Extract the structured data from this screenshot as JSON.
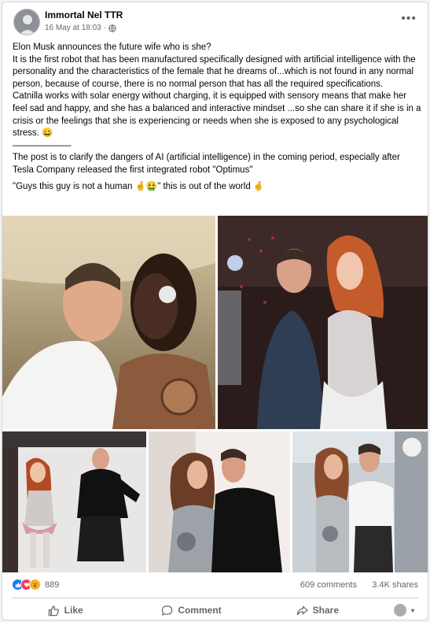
{
  "post": {
    "author": "Immortal Nel TTR",
    "timestamp": "16 May at 18:03",
    "privacy_dot": "·",
    "more_label": "•••",
    "paragraphs": [
      "Elon Musk announces the future wife who is she?",
      "It is the first robot that has been manufactured specifically designed with artificial intelligence with the personality and the characteristics of the female that he dreams of...which is not found in any normal person, because of course, there is no normal person that has all the required specifications.",
      "Catnilla works with solar energy without charging, it is equipped with sensory means that make her feel sad and happy, and she has a balanced and interactive mindset ...so she can share it if she is in a crisis or the feelings that she is experiencing or needs when she is exposed to any psychological stress. 😀"
    ],
    "separator": "———————",
    "note": "The post is to clarify the dangers of AI (artificial intelligence) in the coming period, especially after Tesla Company released the first integrated robot \"Optimus\"",
    "quote": "\"Guys this guy is not a human 🤞🤮\" this is out of the world 🤞"
  },
  "photos": [
    {
      "name": "photo-man-kissing-dark-robot"
    },
    {
      "name": "photo-man-dancing-redhead-robot"
    },
    {
      "name": "photo-man-dancing-robot-studio"
    },
    {
      "name": "photo-man-kissing-robot"
    },
    {
      "name": "photo-man-embracing-robot-lab"
    }
  ],
  "stats": {
    "reaction_count": "889",
    "comments": "609 comments",
    "shares": "3.4K shares",
    "reactions": [
      "like-icon",
      "love-icon",
      "wow-icon"
    ]
  },
  "actions": {
    "like": "Like",
    "comment": "Comment",
    "share": "Share",
    "caret": "▾"
  },
  "colors": {
    "accent": "#1877f2",
    "secondary_text": "#65676b",
    "divider": "#ced0d4"
  }
}
